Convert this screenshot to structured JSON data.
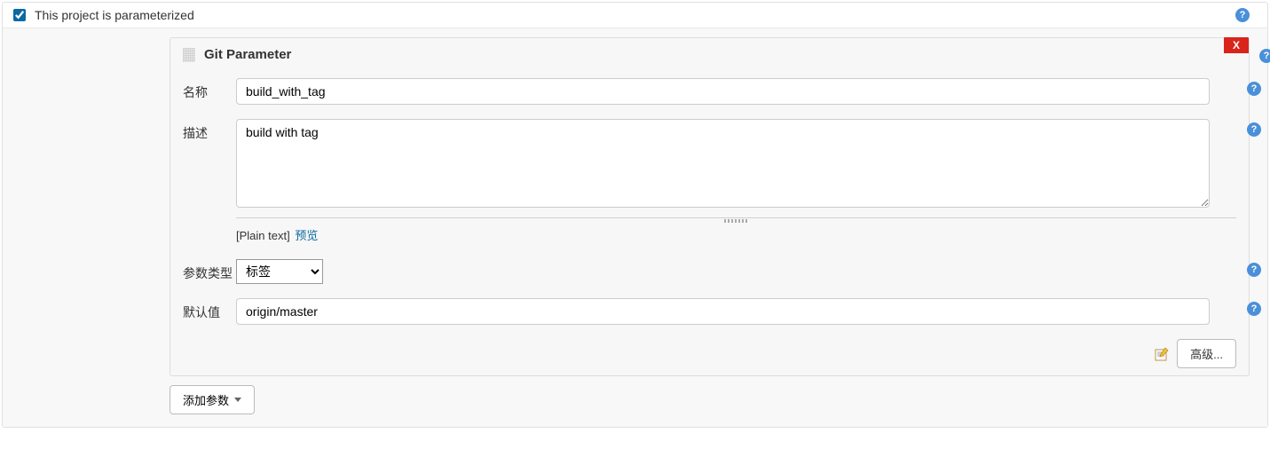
{
  "parameterized": {
    "label": "This project is parameterized",
    "checked": true
  },
  "gitParameter": {
    "title": "Git Parameter",
    "deleteLabel": "X",
    "fields": {
      "name": {
        "label": "名称",
        "value": "build_with_tag"
      },
      "description": {
        "label": "描述",
        "value": "build with tag"
      },
      "paramType": {
        "label": "参数类型",
        "value": "标签",
        "options": [
          "标签"
        ]
      },
      "defaultValue": {
        "label": "默认值",
        "value": "origin/master"
      }
    },
    "preview": {
      "format": "[Plain text]",
      "link": "预览"
    },
    "advancedLabel": "高级..."
  },
  "addParameterLabel": "添加参数"
}
